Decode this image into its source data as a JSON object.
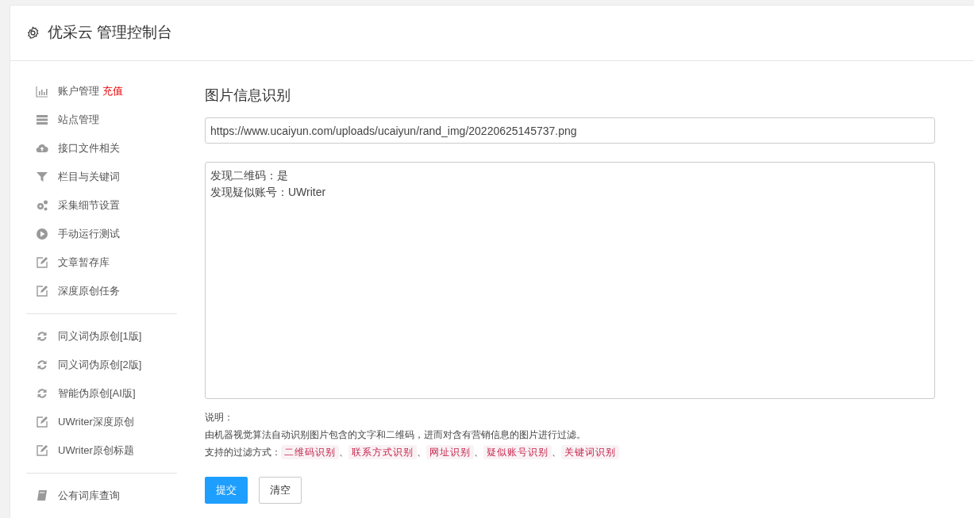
{
  "header": {
    "title": "优采云 管理控制台"
  },
  "sidebar": {
    "groups": [
      {
        "items": [
          {
            "kind": "chart",
            "label": "账户管理",
            "badge": "充值"
          },
          {
            "kind": "server",
            "label": "站点管理"
          },
          {
            "kind": "cloud",
            "label": "接口文件相关"
          },
          {
            "kind": "filter",
            "label": "栏目与关键词"
          },
          {
            "kind": "gears",
            "label": "采集细节设置"
          },
          {
            "kind": "play",
            "label": "手动运行测试"
          },
          {
            "kind": "edit",
            "label": "文章暂存库"
          },
          {
            "kind": "edit",
            "label": "深度原创任务"
          }
        ]
      },
      {
        "items": [
          {
            "kind": "refresh",
            "label": "同义词伪原创[1版]"
          },
          {
            "kind": "refresh",
            "label": "同义词伪原创[2版]"
          },
          {
            "kind": "refresh",
            "label": "智能伪原创[AI版]"
          },
          {
            "kind": "edit",
            "label": "UWriter深度原创"
          },
          {
            "kind": "edit",
            "label": "UWriter原创标题"
          }
        ]
      },
      {
        "items": [
          {
            "kind": "book",
            "label": "公有词库查询"
          }
        ]
      }
    ]
  },
  "main": {
    "title": "图片信息识别",
    "url_field": {
      "value": "https://www.ucaiyun.com/uploads/ucaiyun/rand_img/20220625145737.png"
    },
    "result_box": {
      "lines": [
        "发现二维码：是",
        "发现疑似账号：UWriter"
      ]
    },
    "notes": {
      "heading": "说明：",
      "description": "由机器视觉算法自动识别图片包含的文字和二维码，进而对含有营销信息的图片进行过滤。",
      "filters_label": "支持的过滤方式：",
      "separator": "、",
      "filters": [
        "二维码识别",
        "联系方式识别",
        "网址识别",
        "疑似账号识别",
        "关键词识别"
      ]
    },
    "buttons": [
      {
        "label": "提交",
        "kind": "primary"
      },
      {
        "label": "清空",
        "kind": "default"
      }
    ]
  }
}
